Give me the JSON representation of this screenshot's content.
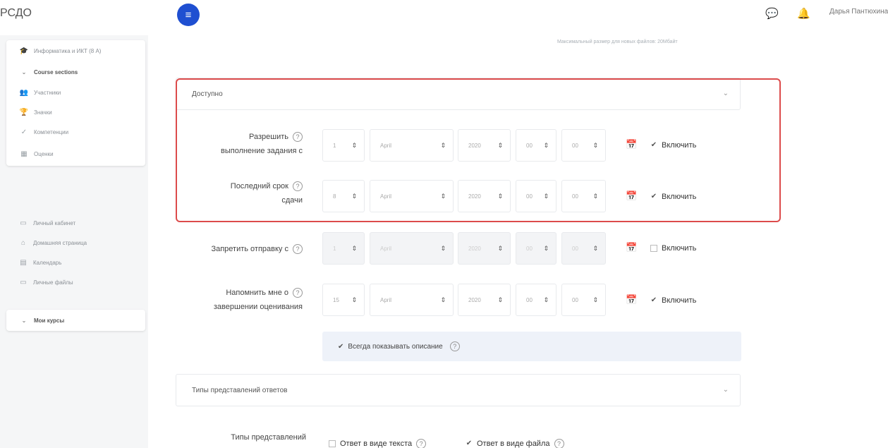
{
  "header": {
    "brand": "РСДО",
    "menu_icon": "≡",
    "user_name": "Дарья Пантюхина"
  },
  "sidebar": {
    "course_items": [
      {
        "icon": "🎓",
        "label": "Информатика и ИКТ (8 А)"
      },
      {
        "icon": "⌄",
        "label": "Course sections",
        "section": true
      },
      {
        "icon": "👥",
        "label": "Участники"
      },
      {
        "icon": "🏆",
        "label": "Значки"
      },
      {
        "icon": "✓",
        "label": "Компетенции"
      },
      {
        "icon": "▦",
        "label": "Оценки"
      }
    ],
    "main_items": [
      {
        "icon": "▭",
        "label": "Личный кабинет"
      },
      {
        "icon": "⌂",
        "label": "Домашняя страница"
      },
      {
        "icon": "▤",
        "label": "Календарь"
      },
      {
        "icon": "▭",
        "label": "Личные файлы"
      }
    ],
    "my_courses": {
      "icon": "⌄",
      "label": "Мои курсы"
    }
  },
  "main": {
    "max_size_hint": "Максимальный размер для новых файлов: 20Мбайт",
    "available_section": "Доступно",
    "rows": [
      {
        "label_lines": [
          "Разрешить",
          "выполнение задания с"
        ],
        "day": "1",
        "month": "April",
        "year": "2020",
        "hour": "00",
        "minute": "00",
        "enable_label": "Включить",
        "enabled": true
      },
      {
        "label_lines": [
          "Последний срок",
          "сдачи"
        ],
        "day": "8",
        "month": "April",
        "year": "2020",
        "hour": "00",
        "minute": "00",
        "enable_label": "Включить",
        "enabled": true
      },
      {
        "label_lines": [
          "Запретить отправку с"
        ],
        "day": "1",
        "month": "April",
        "year": "2020",
        "hour": "00",
        "minute": "00",
        "enable_label": "Включить",
        "enabled": false
      },
      {
        "label_lines": [
          "Напомнить мне о",
          "завершении оценивания"
        ],
        "day": "15",
        "month": "April",
        "year": "2020",
        "hour": "00",
        "minute": "00",
        "enable_label": "Включить",
        "enabled": true
      }
    ],
    "always_show_description": "Всегда показывать описание",
    "submission_types_section": "Типы представлений ответов",
    "submission_types_label": "Типы представлений",
    "online_text": "Ответ в виде текста",
    "file_submission": "Ответ в виде файла"
  }
}
